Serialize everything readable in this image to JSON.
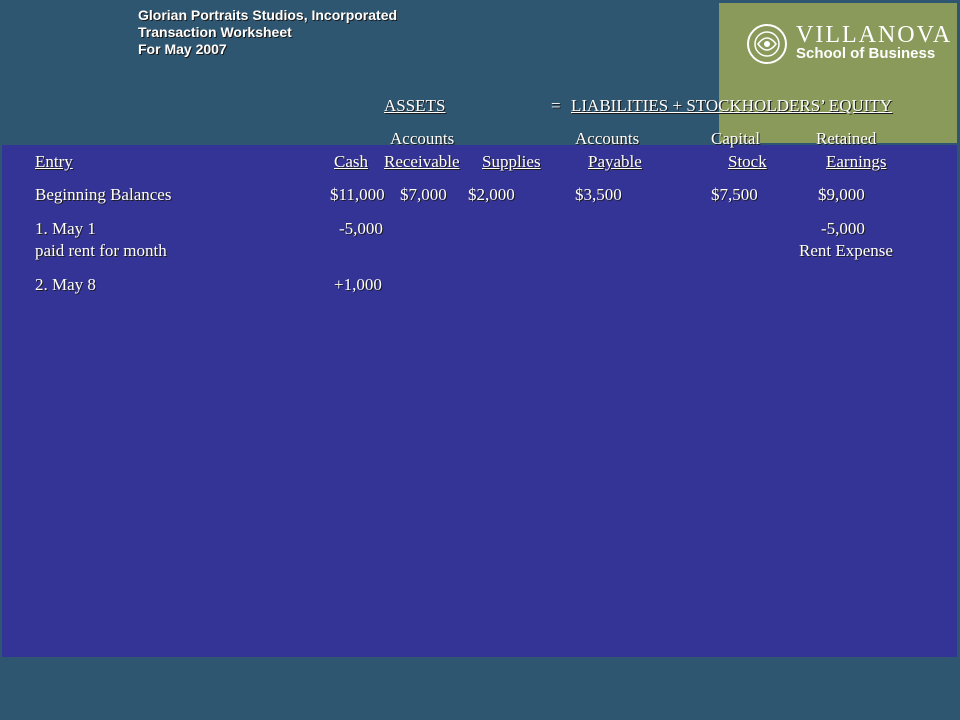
{
  "header": {
    "company": "Glorian Portraits Studios, Incorporated",
    "title": "Transaction Worksheet",
    "period": "For May 2007"
  },
  "logo": {
    "name": "VILLANOVA",
    "school": "School of Business",
    "bg_color": "#8a9a5b"
  },
  "equation": {
    "assets": "ASSETS",
    "rhs": "=",
    "liab_equity": "LIABILITIES + STOCKHOLDERS’ EQUITY"
  },
  "columns": {
    "entry": "Entry",
    "cash": "Cash",
    "ar_top": "Accounts",
    "ar_bottom": "Receivable",
    "supplies": "Supplies",
    "ap_top": "Accounts",
    "ap_bottom": "Payable",
    "cs_top": "Capital",
    "cs_bottom": "Stock",
    "re_top": "Retained",
    "re_bottom": "Earnings"
  },
  "rows": {
    "beginning": {
      "label": "Beginning Balances",
      "cash": "$11,000",
      "ar": "$7,000",
      "supplies": "$2,000",
      "ap": "$3,500",
      "cs": "$7,500",
      "re": "$9,000"
    },
    "entry1": {
      "label": "1. May 1",
      "desc": "paid rent for month",
      "cash": "-5,000",
      "re": "-5,000",
      "re_note": "Rent Expense"
    },
    "entry2": {
      "label": "2. May 8",
      "cash": "+1,000"
    }
  },
  "colors": {
    "background": "#2f5670",
    "panel": "#343396",
    "text": "#ffffff"
  }
}
